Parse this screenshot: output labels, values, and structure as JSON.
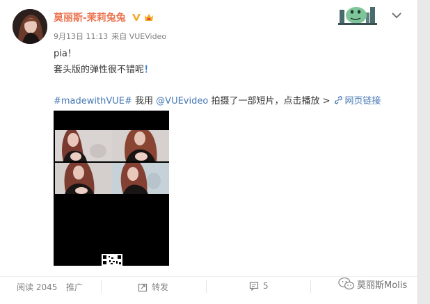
{
  "post": {
    "username": "莫丽斯-茉莉兔兔",
    "date": "9月13日 11:13",
    "source": "来自 VUEVideo",
    "line1": "pia！",
    "line2_text": "套头版的弹性很不错呢",
    "line2_exclaim": "！",
    "hashtag": "#madewithVUE#",
    "using": "我用",
    "mention": "@VUEvideo",
    "shot_text": "拍摄了一部短片，点击播放 >",
    "web_link": "网页链接"
  },
  "footer": {
    "reads": "阅读 2045",
    "promote": "推广",
    "repost": "转发",
    "comments": "5"
  },
  "watermark": "莫丽斯Molis",
  "icons": [
    "verified-v-icon",
    "vip-level-icon",
    "dinosaur-sticker-icon",
    "chevron-down-icon",
    "link-icon",
    "repost-icon",
    "comment-icon",
    "wechat-icon"
  ],
  "colors": {
    "username": "#eb7350",
    "link": "#4577b4",
    "exclaim": "#2a7bd1",
    "meta": "#808080"
  }
}
